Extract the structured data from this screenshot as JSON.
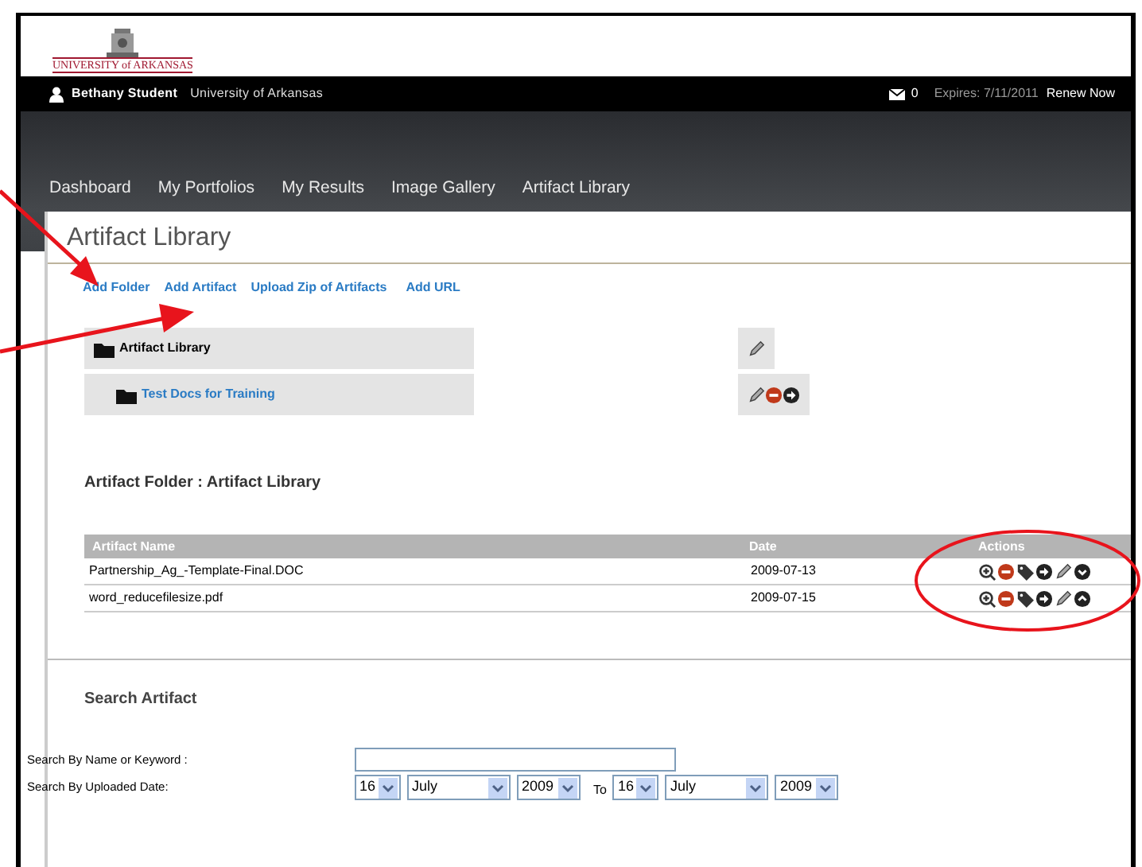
{
  "logo": {
    "text": "UNIVERSITY of ARKANSAS"
  },
  "top_bar": {
    "user": "Bethany Student",
    "institution": "University of Arkansas",
    "messages": "0",
    "expires": "Expires: 7/11/2011",
    "renew": "Renew Now"
  },
  "nav": [
    {
      "label": "Dashboard"
    },
    {
      "label": "My Portfolios"
    },
    {
      "label": "My Results"
    },
    {
      "label": "Image Gallery"
    },
    {
      "label": "Artifact Library"
    }
  ],
  "page_title": "Artifact Library",
  "links": [
    "Add Folder",
    "Add Artifact",
    "Upload Zip of Artifacts",
    "Add URL"
  ],
  "folders": [
    {
      "name": "Artifact Library",
      "kind": "root",
      "actions": [
        {
          "kind": "edit"
        }
      ]
    },
    {
      "name": "Test Docs for Training",
      "kind": "child",
      "actions": [
        {
          "kind": "edit"
        },
        {
          "kind": "delete"
        },
        {
          "kind": "move"
        }
      ]
    }
  ],
  "folder_heading": "Artifact Folder : Artifact Library",
  "table": {
    "columns": [
      "Artifact Name",
      "Date",
      "Actions"
    ],
    "rows": [
      {
        "name": "Partnership_Ag_-Template-Final.DOC",
        "date": "2009-07-13",
        "actions": [
          {
            "kind": "view"
          },
          {
            "kind": "delete"
          },
          {
            "kind": "tag"
          },
          {
            "kind": "move"
          },
          {
            "kind": "edit"
          },
          {
            "kind": "down"
          }
        ]
      },
      {
        "name": "word_reducefilesize.pdf",
        "date": "2009-07-15",
        "actions": [
          {
            "kind": "view"
          },
          {
            "kind": "delete"
          },
          {
            "kind": "tag"
          },
          {
            "kind": "move"
          },
          {
            "kind": "edit"
          },
          {
            "kind": "up"
          }
        ]
      }
    ]
  },
  "search": {
    "heading": "Search Artifact",
    "keyword_label": "Search By Name or Keyword :",
    "date_label": "Search By Uploaded Date:",
    "from": {
      "day": "16",
      "month": "July",
      "year": "2009"
    },
    "to_label": "To",
    "to": {
      "day": "16",
      "month": "July",
      "year": "2009"
    }
  }
}
